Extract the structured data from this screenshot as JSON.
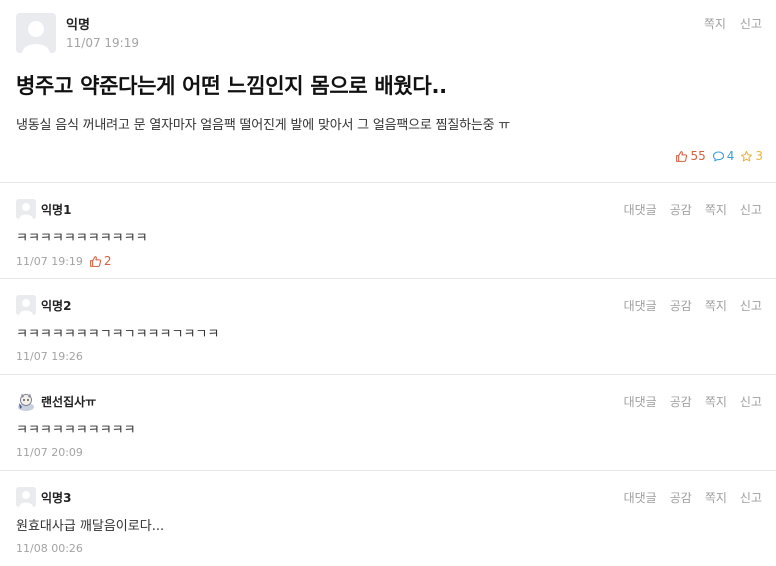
{
  "post": {
    "author": "익명",
    "time": "11/07 19:19",
    "actions": {
      "message": "쪽지",
      "report": "신고"
    },
    "title": "병주고 약준다는게 어떤 느낌인지 몸으로 배웠다..",
    "body": "냉동실 음식 꺼내려고 문 열자마자 얼음팩 떨어진게 발에 맞아서 그 얼음팩으로 찜질하는중 ㅠ",
    "stats": {
      "likes": "55",
      "comments": "4",
      "scraps": "3"
    },
    "colors": {
      "like": "#d3603f",
      "comment": "#3a9fd6",
      "scrap": "#e9b33a"
    }
  },
  "comment_actions": {
    "reply": "대댓글",
    "vote": "공감",
    "message": "쪽지",
    "report": "신고"
  },
  "comments": [
    {
      "author": "익명1",
      "text": "ㅋㅋㅋㅋㅋㅋㅋㅋㅋㅋㅋ",
      "time": "11/07 19:19",
      "likes": "2",
      "avatar": "default-avatar-icon"
    },
    {
      "author": "익명2",
      "text": "ㅋㅋㅋㅋㅋㅋㅋㄱㅋㄱㅋㅋㅋㄱㅋㄱㅋ",
      "time": "11/07 19:26",
      "avatar": "default-avatar-icon"
    },
    {
      "author": "랜선집사ㅠ",
      "text": "ㅋㅋㅋㅋㅋㅋㅋㅋㅋㅋ",
      "time": "11/07 20:09",
      "avatar": "character-avatar-icon"
    },
    {
      "author": "익명3",
      "text": "원효대사급 깨달음이로다...",
      "time": "11/08 00:26",
      "avatar": "default-avatar-icon"
    }
  ]
}
